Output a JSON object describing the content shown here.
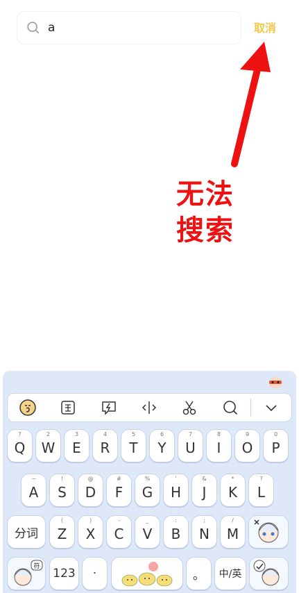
{
  "search": {
    "value": "a"
  },
  "cancel_label": "取消",
  "annotation": {
    "line1": "无法",
    "line2": "搜索",
    "color": "#ee1111"
  },
  "keyboard": {
    "row1": [
      {
        "main": "Q",
        "sub": "?"
      },
      {
        "main": "W",
        "sub": "2"
      },
      {
        "main": "E",
        "sub": "3"
      },
      {
        "main": "R",
        "sub": "4"
      },
      {
        "main": "T",
        "sub": "5"
      },
      {
        "main": "Y",
        "sub": "6"
      },
      {
        "main": "U",
        "sub": "7"
      },
      {
        "main": "I",
        "sub": "8"
      },
      {
        "main": "O",
        "sub": "9"
      },
      {
        "main": "P",
        "sub": "0"
      }
    ],
    "row2": [
      {
        "main": "A",
        "sub": "~"
      },
      {
        "main": "S",
        "sub": "!"
      },
      {
        "main": "D",
        "sub": "@"
      },
      {
        "main": "F",
        "sub": "#"
      },
      {
        "main": "G",
        "sub": "%"
      },
      {
        "main": "H",
        "sub": "'"
      },
      {
        "main": "J",
        "sub": "&"
      },
      {
        "main": "K",
        "sub": "*"
      },
      {
        "main": "L",
        "sub": "?"
      }
    ],
    "row3_fn": "分词",
    "row3": [
      {
        "main": "Z",
        "sub": "("
      },
      {
        "main": "X",
        "sub": ")"
      },
      {
        "main": "C",
        "sub": "-"
      },
      {
        "main": "V",
        "sub": "_"
      },
      {
        "main": "B",
        "sub": ":"
      },
      {
        "main": "N",
        "sub": ";"
      },
      {
        "main": "M",
        "sub": "/"
      }
    ],
    "row4_num": "123",
    "row4_dot1": "·",
    "row4_dot2": "。",
    "row4_lang": "中/英"
  },
  "colors": {
    "accent": "#f2c744",
    "keyboard_bg": "#dfe8f8",
    "key_border": "#c5d3ea"
  }
}
